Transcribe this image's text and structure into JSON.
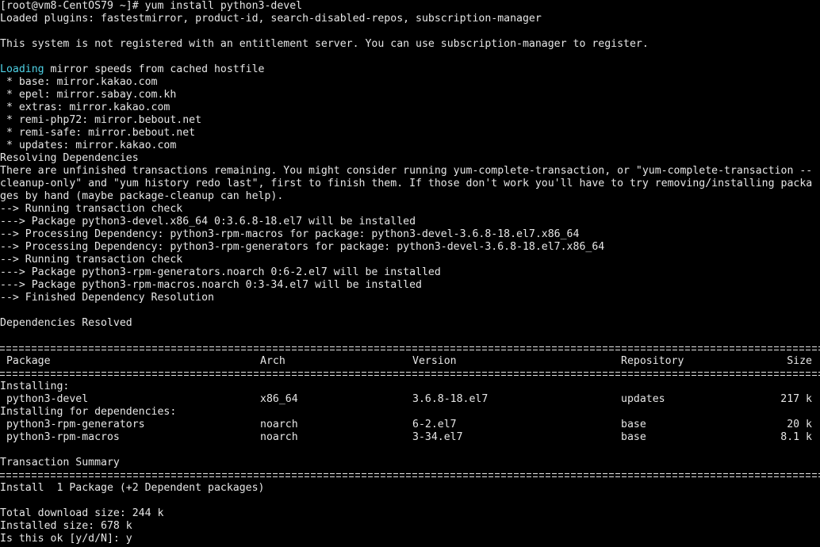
{
  "terminal": {
    "prompt_line": "[root@vm8-CentOS79 ~]# yum install python3-devel",
    "plugins_line": "Loaded plugins: fastestmirror, product-id, search-disabled-repos, subscription-manager",
    "not_registered": "This system is not registered with an entitlement server. You can use subscription-manager to register.",
    "loading_word": "Loading",
    "loading_rest": " mirror speeds from cached hostfile",
    "mirrors": [
      " * base: mirror.kakao.com",
      " * epel: mirror.sabay.com.kh",
      " * extras: mirror.kakao.com",
      " * remi-php72: mirror.bebout.net",
      " * remi-safe: mirror.bebout.net",
      " * updates: mirror.kakao.com"
    ],
    "resolving": "Resolving Dependencies",
    "unfinished": [
      "There are unfinished transactions remaining. You might consider running yum-complete-transaction, or \"yum-complete-transaction --",
      "cleanup-only\" and \"yum history redo last\", first to finish them. If those don't work you'll have to try removing/installing packa",
      "ges by hand (maybe package-cleanup can help)."
    ],
    "transaction_lines": [
      "--> Running transaction check",
      "---> Package python3-devel.x86_64 0:3.6.8-18.el7 will be installed",
      "--> Processing Dependency: python3-rpm-macros for package: python3-devel-3.6.8-18.el7.x86_64",
      "--> Processing Dependency: python3-rpm-generators for package: python3-devel-3.6.8-18.el7.x86_64",
      "--> Running transaction check",
      "---> Package python3-rpm-generators.noarch 0:6-2.el7 will be installed",
      "---> Package python3-rpm-macros.noarch 0:3-34.el7 will be installed",
      "--> Finished Dependency Resolution"
    ],
    "deps_resolved": "Dependencies Resolved",
    "table": {
      "headers": {
        "package": " Package",
        "arch": "Arch",
        "version": "Version",
        "repository": "Repository",
        "size": "Size"
      },
      "installing_label": "Installing:",
      "installing_rows": [
        {
          "package": " python3-devel",
          "arch": "x86_64",
          "version": "3.6.8-18.el7",
          "repository": "updates",
          "size": "217 k"
        }
      ],
      "deps_label": "Installing for dependencies:",
      "deps_rows": [
        {
          "package": " python3-rpm-generators",
          "arch": "noarch",
          "version": "6-2.el7",
          "repository": "base",
          "size": "20 k"
        },
        {
          "package": " python3-rpm-macros",
          "arch": "noarch",
          "version": "3-34.el7",
          "repository": "base",
          "size": "8.1 k"
        }
      ]
    },
    "transaction_summary": "Transaction Summary",
    "install_summary": "Install  1 Package (+2 Dependent packages)",
    "total_download": "Total download size: 244 k",
    "installed_size": "Installed size: 678 k",
    "confirm_prompt": "Is this ok [y/d/N]: y"
  },
  "colors": {
    "background": "#000000",
    "text": "#e6e6e6",
    "highlight": "#4fd2e6"
  }
}
